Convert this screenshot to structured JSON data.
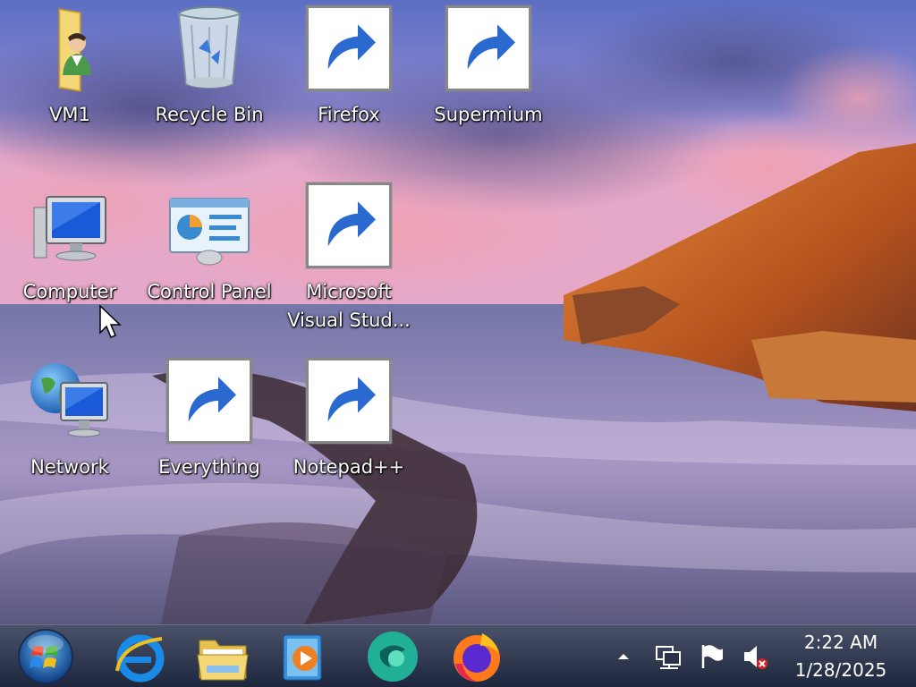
{
  "desktop_icons": [
    {
      "label": "VM1",
      "icon": "user-folder-icon",
      "shortcut": false
    },
    {
      "label": "Recycle Bin",
      "icon": "recycle-bin-icon",
      "shortcut": false
    },
    {
      "label": "Firefox",
      "icon": "firefox-icon",
      "shortcut": true
    },
    {
      "label": "Supermium",
      "icon": "supermium-icon",
      "shortcut": true
    },
    {
      "label": "Computer",
      "icon": "computer-icon",
      "shortcut": false
    },
    {
      "label": "Control Panel",
      "icon": "control-panel-icon",
      "shortcut": false
    },
    {
      "label": "Microsoft\nVisual Stud...",
      "icon": "visual-studio-icon",
      "shortcut": true
    },
    {
      "label": "Network",
      "icon": "network-icon",
      "shortcut": false
    },
    {
      "label": "Everything",
      "icon": "everything-search-icon",
      "shortcut": true
    },
    {
      "label": "Notepad++",
      "icon": "notepad-plus-plus-icon",
      "shortcut": true
    }
  ],
  "taskbar": {
    "start": "windows-start-orb-icon",
    "pinned": [
      "internet-explorer-icon",
      "file-explorer-icon",
      "media-player-icon",
      "supermium-icon",
      "firefox-icon"
    ]
  },
  "tray": {
    "icons": [
      "show-hidden-icons-arrow",
      "network-icon",
      "action-center-flag-icon",
      "volume-muted-icon"
    ],
    "time": "2:22 AM",
    "date": "1/28/2025"
  },
  "colors": {
    "taskbar": "#2a3448",
    "sky": "#6f7fc8",
    "sea": "#8a8ab8",
    "rocks": "#c8642a"
  }
}
